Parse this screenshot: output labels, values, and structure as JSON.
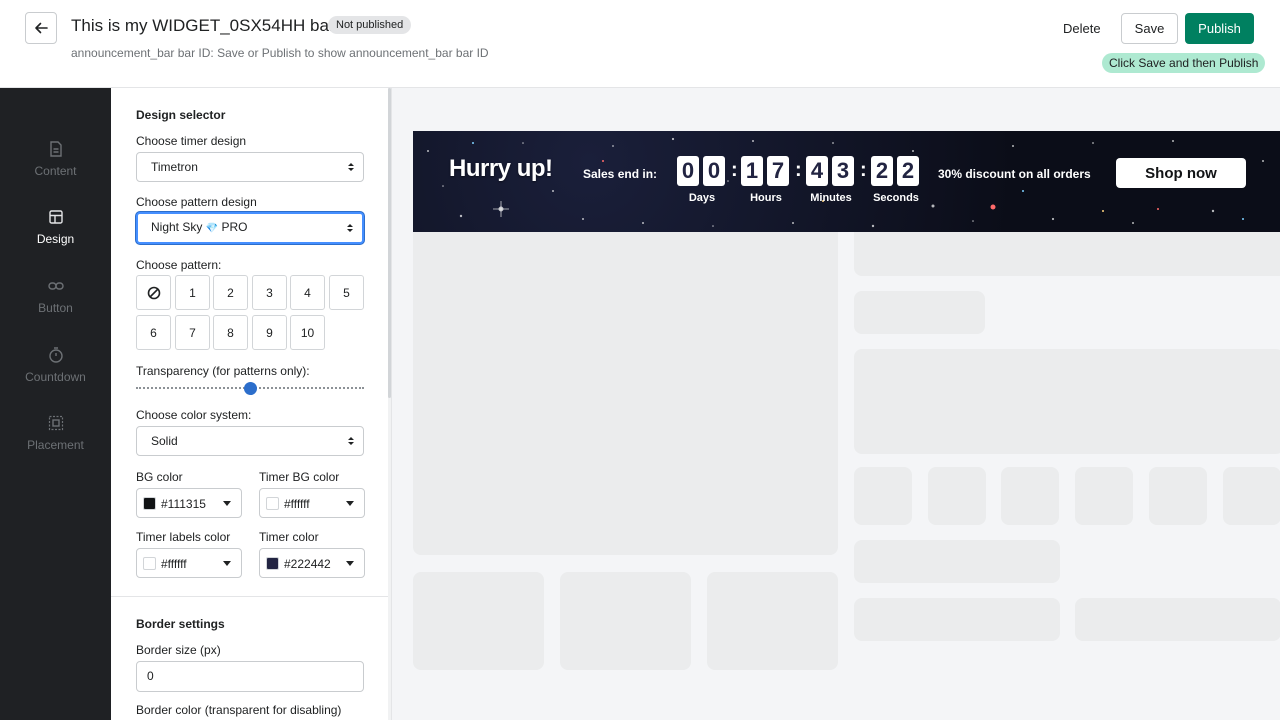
{
  "header": {
    "title": "This is my WIDGET_0SX54HH bar",
    "status_badge": "Not published",
    "subtitle": "announcement_bar bar ID: Save or Publish to show announcement_bar bar ID",
    "delete_label": "Delete",
    "save_label": "Save",
    "publish_label": "Publish",
    "hint": "Click Save and then Publish"
  },
  "rail": {
    "items": [
      {
        "label": "Content",
        "icon": "document-icon",
        "active": false
      },
      {
        "label": "Design",
        "icon": "layout-icon",
        "active": true
      },
      {
        "label": "Button",
        "icon": "link-icon",
        "active": false
      },
      {
        "label": "Countdown",
        "icon": "timer-icon",
        "active": false
      },
      {
        "label": "Placement",
        "icon": "placement-icon",
        "active": false
      }
    ]
  },
  "design": {
    "section_title": "Design selector",
    "timer_design_label": "Choose timer design",
    "timer_design_value": "Timetron",
    "pattern_design_label": "Choose pattern design",
    "pattern_design_value": "Night Sky",
    "pattern_design_gem": "💎",
    "pattern_design_suffix": "PRO",
    "pattern_label": "Choose pattern:",
    "patterns": [
      "1",
      "2",
      "3",
      "4",
      "5",
      "6",
      "7",
      "8",
      "9",
      "10"
    ],
    "transparency_label": "Transparency (for patterns only):",
    "transparency_value": 0.5,
    "color_system_label": "Choose color system:",
    "color_system_value": "Solid",
    "bg_color_label": "BG color",
    "bg_color_value": "#111315",
    "timer_bg_color_label": "Timer BG color",
    "timer_bg_color_value": "#ffffff",
    "timer_labels_color_label": "Timer labels color",
    "timer_labels_color_value": "#ffffff",
    "timer_color_label": "Timer color",
    "timer_color_value": "#222442"
  },
  "border": {
    "section_title": "Border settings",
    "size_label": "Border size (px)",
    "size_value": "0",
    "color_label": "Border color (transparent for disabling)"
  },
  "preview_bar": {
    "headline": "Hurry up!",
    "sales_end": "Sales end in:",
    "days": [
      "0",
      "0"
    ],
    "hours": [
      "1",
      "7"
    ],
    "minutes": [
      "4",
      "3"
    ],
    "seconds": [
      "2",
      "2"
    ],
    "labels": {
      "days": "Days",
      "hours": "Hours",
      "minutes": "Minutes",
      "seconds": "Seconds"
    },
    "colon": ":",
    "discount": "30% discount on all orders",
    "button_label": "Shop now"
  },
  "colors": {
    "accent": "#008060",
    "hint_bg": "#aee9d1",
    "focus": "#458fff",
    "rail_bg": "#1f2124",
    "timer_digit": "#222442"
  }
}
